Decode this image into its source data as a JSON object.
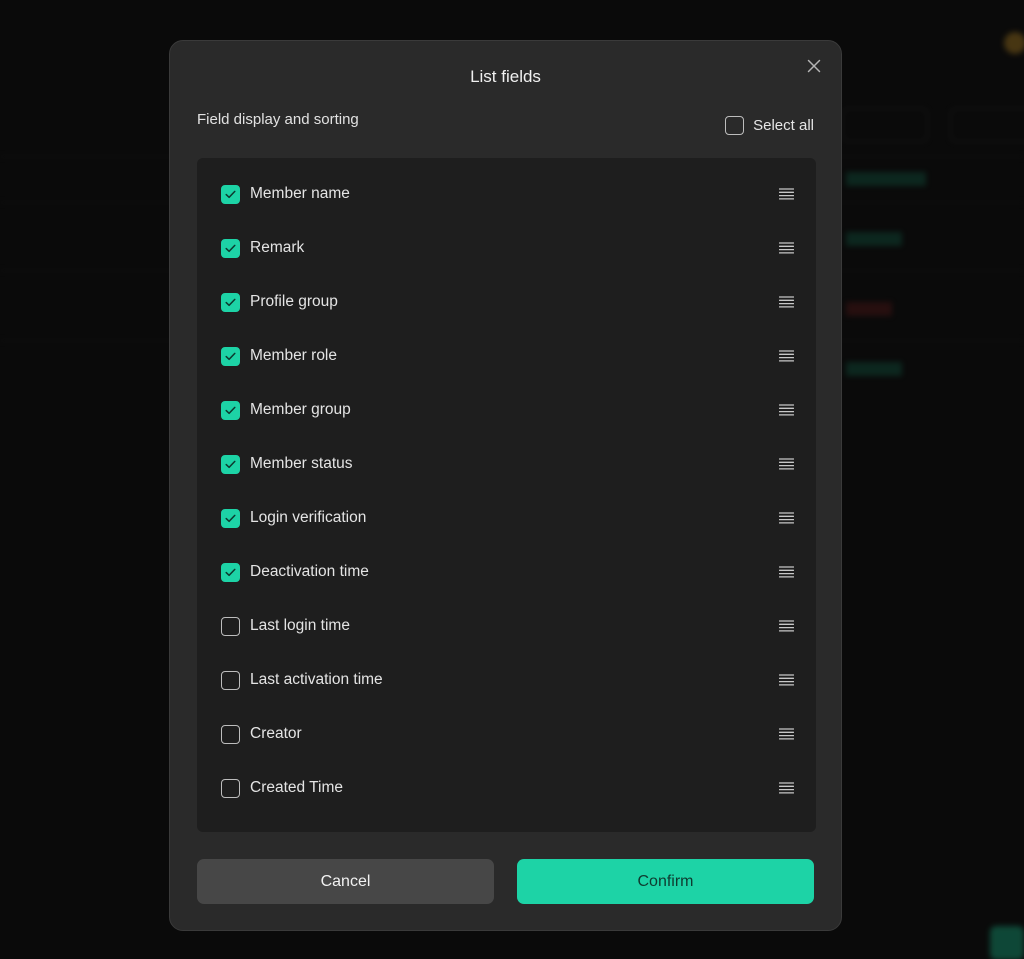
{
  "dialog": {
    "title": "List fields",
    "section_label": "Field display and sorting",
    "select_all_label": "Select all",
    "select_all_checked": false,
    "cancel_label": "Cancel",
    "confirm_label": "Confirm",
    "accent_color": "#1dd3a6"
  },
  "fields": [
    {
      "label": "Member name",
      "checked": true
    },
    {
      "label": "Remark",
      "checked": true
    },
    {
      "label": "Profile group",
      "checked": true
    },
    {
      "label": "Member role",
      "checked": true
    },
    {
      "label": "Member group",
      "checked": true
    },
    {
      "label": "Member status",
      "checked": true
    },
    {
      "label": "Login verification",
      "checked": true
    },
    {
      "label": "Deactivation time",
      "checked": true
    },
    {
      "label": "Last login time",
      "checked": false
    },
    {
      "label": "Last activation time",
      "checked": false
    },
    {
      "label": "Creator",
      "checked": false
    },
    {
      "label": "Created Time",
      "checked": false
    }
  ],
  "icons": {
    "close": "close-icon",
    "drag": "drag-handle-icon",
    "check": "check-icon"
  }
}
